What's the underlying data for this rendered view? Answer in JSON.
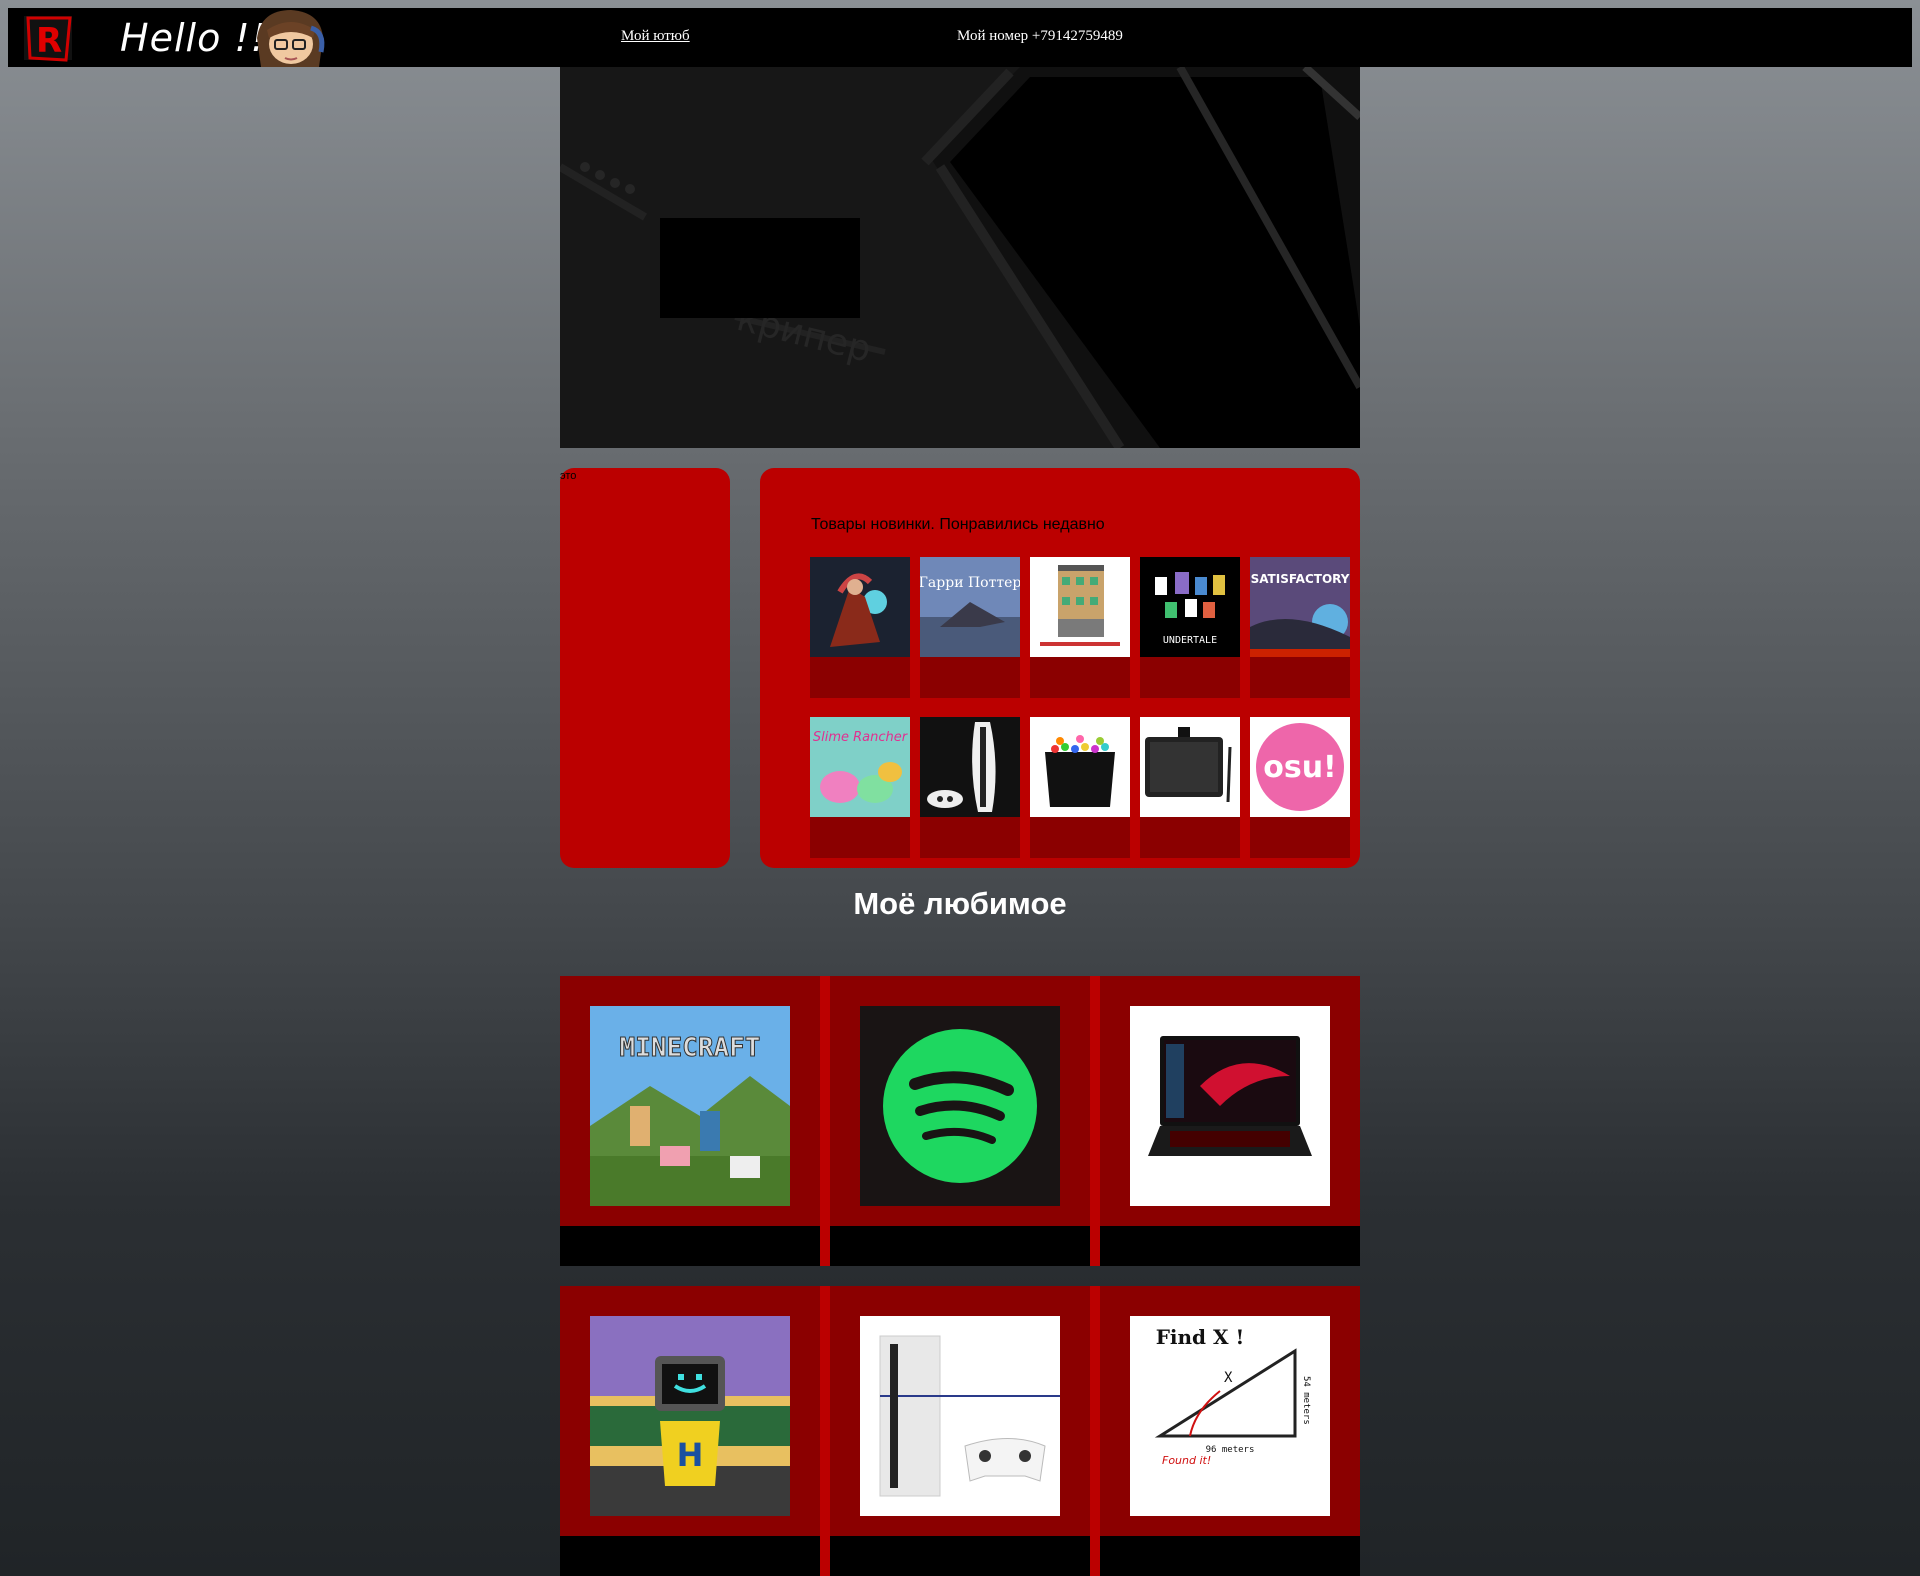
{
  "header": {
    "logo_letter": "R",
    "greeting": "Hello !!",
    "youtube_link": "Мой ютюб",
    "phone": "Мой номер +79142759489"
  },
  "banner": {
    "watermark": "крипер"
  },
  "side_panel": {
    "label": "это"
  },
  "shop": {
    "title": "Товары новинки. Понравились недавно",
    "products": [
      {
        "icon": "fantasy-game-art"
      },
      {
        "icon": "book-cover",
        "text": "Гарри Поттер"
      },
      {
        "icon": "lego-building-set"
      },
      {
        "icon": "undertale-game",
        "text": "UNDERTALE"
      },
      {
        "icon": "satisfactory-game",
        "text": "SATISFACTORY"
      },
      {
        "icon": "slime-rancher-game",
        "text": "Slime Rancher"
      },
      {
        "icon": "ps5-console"
      },
      {
        "icon": "markers-set"
      },
      {
        "icon": "graphics-tablet"
      },
      {
        "icon": "osu-game",
        "text": "osu!"
      }
    ]
  },
  "favorites": {
    "title": "Моё любимое",
    "items": [
      {
        "icon": "minecraft-cover",
        "text": "MINECRAFT"
      },
      {
        "icon": "spotify-logo"
      },
      {
        "icon": "gaming-laptop"
      },
      {
        "icon": "robot-character",
        "text": "H"
      },
      {
        "icon": "ps4-console"
      },
      {
        "icon": "find-x-meme",
        "text": "Find X !",
        "side": "54 meters",
        "base": "96 meters",
        "note": "Found it!",
        "x": "X"
      }
    ]
  },
  "colors": {
    "panel_red": "#bb0000",
    "dark_red": "#8b0000",
    "topbar": "#000000"
  }
}
